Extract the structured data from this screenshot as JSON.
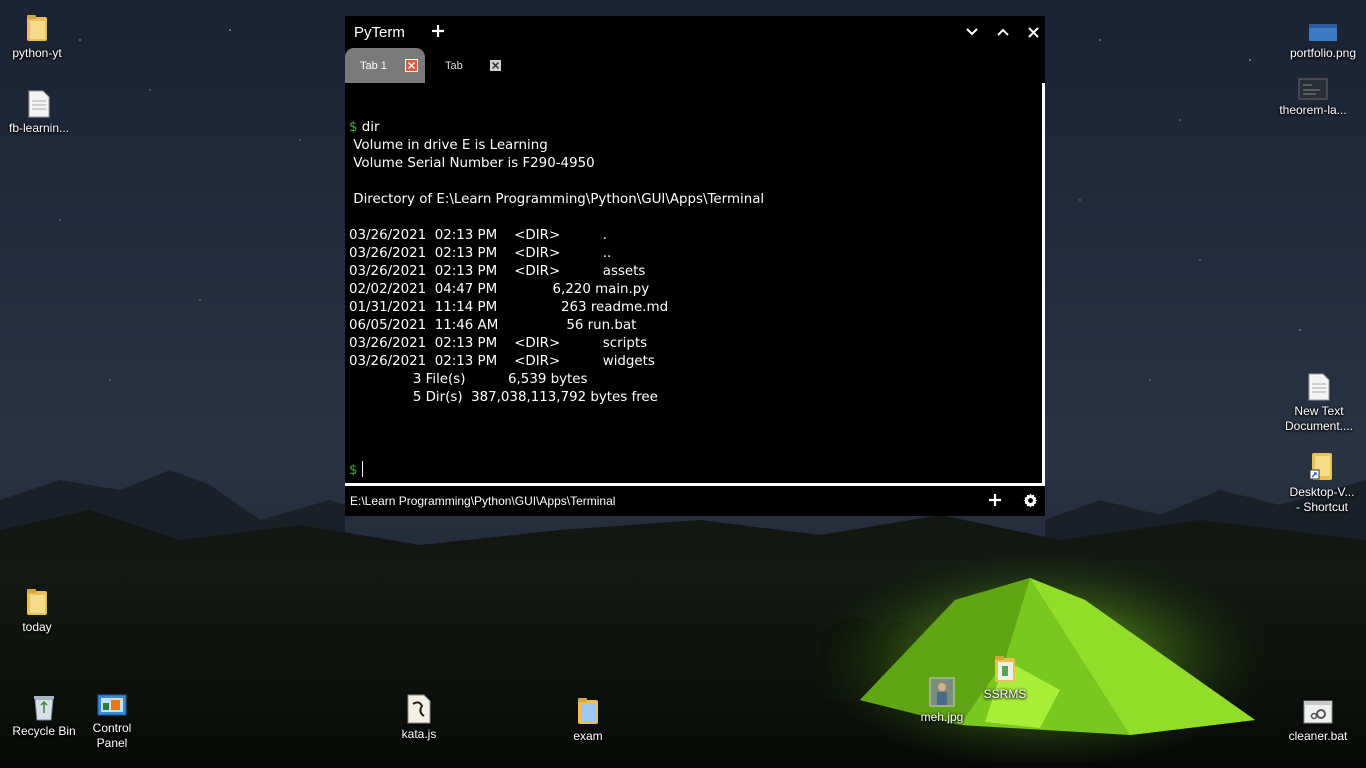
{
  "desktop": {
    "icons": {
      "python_yt": "python-yt",
      "fb_learning": "fb-learnin...",
      "portfolio": "portfolio.png",
      "theorem": "theorem-la...",
      "new_text_1": "New Text",
      "new_text_2": "Document....",
      "desktop_v_1": "Desktop-V...",
      "desktop_v_2": "- Shortcut",
      "today": "today",
      "recycle_bin": "Recycle Bin",
      "control_1": "Control",
      "control_2": "Panel",
      "kata": "kata.js",
      "exam": "exam",
      "meh": "meh.jpg",
      "ssrms": "SSRMS",
      "cleaner": "cleaner.bat"
    }
  },
  "terminal": {
    "title": "PyTerm",
    "tabs": [
      {
        "label": "Tab 1",
        "active": true
      },
      {
        "label": "Tab",
        "active": false
      }
    ],
    "lines": [
      {
        "prompt": "$",
        "text": " dir"
      },
      {
        "prompt": "",
        "text": " Volume in drive E is Learning"
      },
      {
        "prompt": "",
        "text": " Volume Serial Number is F290-4950"
      },
      {
        "prompt": "",
        "text": ""
      },
      {
        "prompt": "",
        "text": " Directory of E:\\Learn Programming\\Python\\GUI\\Apps\\Terminal"
      },
      {
        "prompt": "",
        "text": ""
      },
      {
        "prompt": "",
        "text": "03/26/2021  02:13 PM    <DIR>          ."
      },
      {
        "prompt": "",
        "text": "03/26/2021  02:13 PM    <DIR>          .."
      },
      {
        "prompt": "",
        "text": "03/26/2021  02:13 PM    <DIR>          assets"
      },
      {
        "prompt": "",
        "text": "02/02/2021  04:47 PM             6,220 main.py"
      },
      {
        "prompt": "",
        "text": "01/31/2021  11:14 PM               263 readme.md"
      },
      {
        "prompt": "",
        "text": "06/05/2021  11:46 AM                56 run.bat"
      },
      {
        "prompt": "",
        "text": "03/26/2021  02:13 PM    <DIR>          scripts"
      },
      {
        "prompt": "",
        "text": "03/26/2021  02:13 PM    <DIR>          widgets"
      },
      {
        "prompt": "",
        "text": "               3 File(s)          6,539 bytes"
      },
      {
        "prompt": "",
        "text": "               5 Dir(s)  387,038,113,792 bytes free"
      },
      {
        "prompt": "",
        "text": ""
      }
    ],
    "input_prompt": "$",
    "input_value": "",
    "status_path": "E:\\Learn Programming\\Python\\GUI\\Apps\\Terminal",
    "colors": {
      "prompt": "#3db33d",
      "active_tab": "#7a7a7a",
      "tab_close_active": "#e05a3c"
    }
  }
}
